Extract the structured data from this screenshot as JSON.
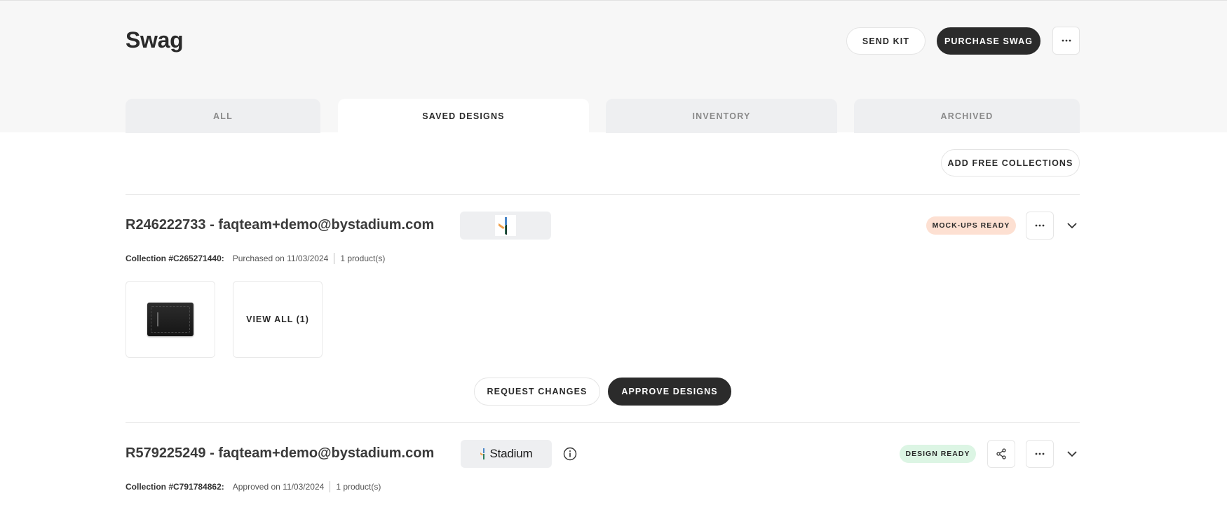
{
  "header": {
    "title": "Swag",
    "send_kit_label": "SEND KIT",
    "purchase_label": "PURCHASE SWAG",
    "more_label": "···"
  },
  "tabs": [
    {
      "label": "ALL",
      "active": false
    },
    {
      "label": "SAVED DESIGNS",
      "active": true
    },
    {
      "label": "INVENTORY",
      "active": false
    },
    {
      "label": "ARCHIVED",
      "active": false
    }
  ],
  "toolbar": {
    "add_collections_label": "ADD FREE COLLECTIONS"
  },
  "orders": [
    {
      "title": "R246222733 - faqteam+demo@bystadium.com",
      "collection_label": "Collection #C265271440:",
      "date_text": "Purchased on 11/03/2024",
      "products_text": "1 product(s)",
      "status": "MOCK-UPS READY",
      "status_color": "#fde0d2",
      "more_label": "···",
      "view_all_label": "VIEW ALL (1)",
      "request_changes_label": "REQUEST CHANGES",
      "approve_label": "APPROVE DESIGNS"
    },
    {
      "title": "R579225249 - faqteam+demo@bystadium.com",
      "logo_text": "Stadium",
      "collection_label": "Collection #C791784862:",
      "date_text": "Approved on 11/03/2024",
      "products_text": "1 product(s)",
      "status": "DESIGN READY",
      "status_color": "#dcf5e4",
      "more_label": "···"
    }
  ],
  "icons": {
    "more": "more-horizontal-icon",
    "chevron": "chevron-down-icon",
    "share": "share-icon",
    "info": "info-icon",
    "logo": "stadium-logo-icon"
  },
  "colors": {
    "dark_button": "#2b2b2b",
    "background_top": "#f7f7f7",
    "tab_inactive": "#eeeff1",
    "logo_orange": "#f0a04b",
    "logo_blue": "#4a86c8",
    "logo_green": "#2f7d5b"
  }
}
